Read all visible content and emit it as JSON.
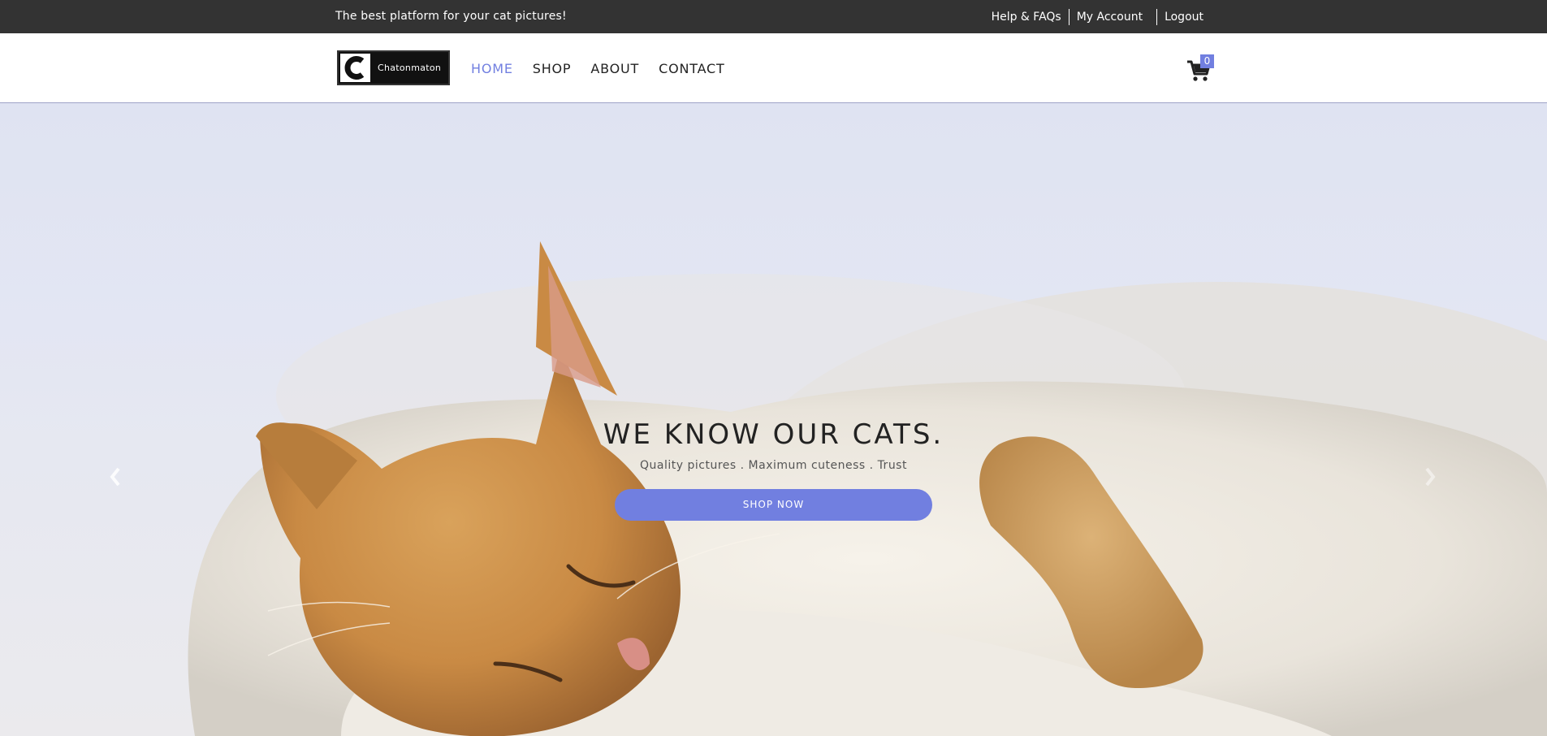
{
  "topbar": {
    "tagline": "The best platform for your cat pictures!",
    "links": [
      {
        "label": "Help & FAQs"
      },
      {
        "label": "My Account"
      },
      {
        "label": "Logout"
      }
    ]
  },
  "header": {
    "logo_text": "Chatonmaton",
    "nav": [
      {
        "label": "HOME",
        "active": true
      },
      {
        "label": "SHOP",
        "active": false
      },
      {
        "label": "ABOUT",
        "active": false
      },
      {
        "label": "CONTACT",
        "active": false
      }
    ],
    "cart_count": "0"
  },
  "hero": {
    "title": "WE KNOW OUR CATS.",
    "subtitle": "Quality pictures . Maximum cuteness . Trust",
    "button_label": "SHOP NOW"
  },
  "colors": {
    "accent": "#717fe0",
    "topbar_bg": "#333333"
  },
  "icons": {
    "cart": "shopping-cart-icon",
    "prev": "chevron-left-icon",
    "next": "chevron-right-icon"
  }
}
